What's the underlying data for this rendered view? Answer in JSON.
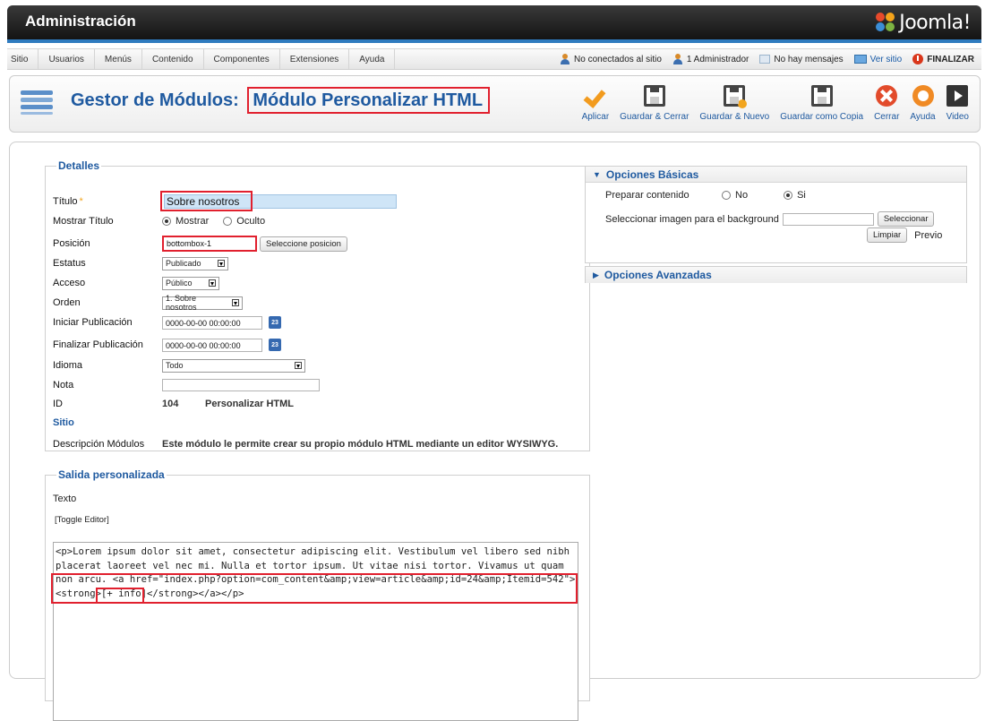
{
  "header": {
    "title": "Administración",
    "logo_text": "Joomla!"
  },
  "menu": {
    "items": [
      "Sitio",
      "Usuarios",
      "Menús",
      "Contenido",
      "Componentes",
      "Extensiones",
      "Ayuda"
    ],
    "status": {
      "not_connected": "No conectados al sitio",
      "admins": "1 Administrador",
      "messages": "No hay mensajes",
      "view_site": "Ver sitio",
      "logout": "FINALIZAR"
    }
  },
  "toolbar": {
    "title": "Gestor de Módulos:",
    "subtitle": "Módulo Personalizar HTML",
    "buttons": [
      "Aplicar",
      "Guardar & Cerrar",
      "Guardar & Nuevo",
      "Guardar como Copia",
      "Cerrar",
      "Ayuda",
      "Video"
    ]
  },
  "details": {
    "legend": "Detalles",
    "title_label": "Título",
    "title_value": "Sobre nosotros",
    "show_title_label": "Mostrar Título",
    "show_option": "Mostrar",
    "hide_option": "Oculto",
    "position_label": "Posición",
    "position_value": "bottombox-1",
    "select_position_button": "Seleccione posicion",
    "status_label": "Estatus",
    "status_value": "Publicado",
    "access_label": "Acceso",
    "access_value": "Público",
    "order_label": "Orden",
    "order_value": "1. Sobre nosotros",
    "start_label": "Iniciar Publicación",
    "start_value": "0000-00-00 00:00:00",
    "end_label": "Finalizar Publicación",
    "end_value": "0000-00-00 00:00:00",
    "calendar_day": "23",
    "language_label": "Idioma",
    "language_value": "Todo",
    "note_label": "Nota",
    "note_value": "",
    "id_label": "ID",
    "id_value": "104",
    "id_type": "Personalizar HTML",
    "site_label": "Sitio",
    "desc_label": "Descripción Módulos",
    "desc_value": "Este módulo le permite crear su propio módulo HTML mediante un editor WYSIWYG."
  },
  "output": {
    "legend": "Salida personalizada",
    "text_label": "Texto",
    "toggle_editor": "[Toggle Editor]",
    "lines": [
      "<p>Lorem ipsum dolor sit amet, consectetur adipiscing elit. Vestibulum vel libero sed nibh",
      "placerat laoreet vel nec mi. Nulla et tortor ipsum. Ut vitae nisi tortor. Vivamus ut quam",
      "non arcu. <a href=\"index.php?option=com_content&amp;view=article&amp;id=24&amp;Itemid=542\">",
      "<strong>[+ info]</strong></a></p>"
    ]
  },
  "basic_options": {
    "title": "Opciones Básicas",
    "prepare_label": "Preparar contenido",
    "no_option": "No",
    "yes_option": "Si",
    "bg_label": "Seleccionar imagen para el background",
    "bg_value": "",
    "select_button": "Seleccionar",
    "clear_button": "Limpiar",
    "preview_label": "Previo"
  },
  "advanced_options": {
    "title": "Opciones Avanzadas"
  }
}
